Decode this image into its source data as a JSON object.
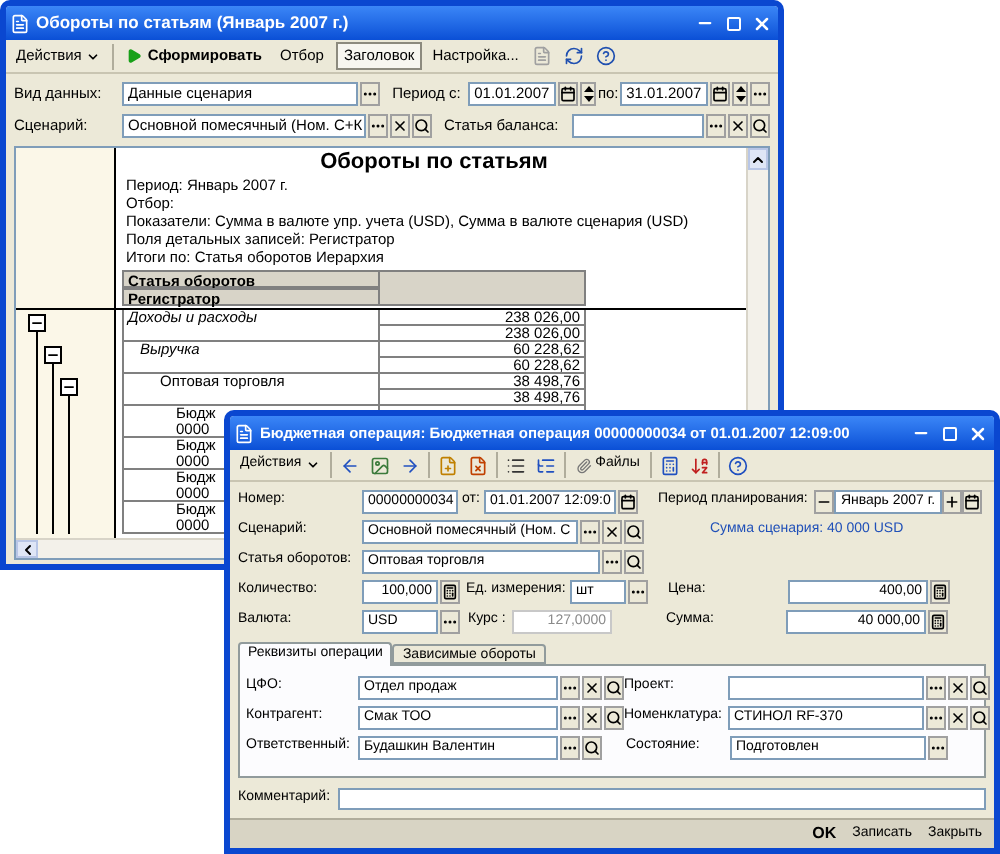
{
  "report_window": {
    "title": "Обороты по статьям (Январь 2007 г.)",
    "toolbar": [
      {
        "kind": "menu",
        "label": "Действия"
      },
      {
        "kind": "run",
        "label": "Сформировать"
      },
      {
        "kind": "toggle",
        "label": "Отбор",
        "selected": false
      },
      {
        "kind": "toggle",
        "label": "Заголовок",
        "selected": true
      },
      {
        "kind": "plain",
        "label": "Настройка..."
      }
    ],
    "data_kind": {
      "label": "Вид данных:",
      "value": "Данные сценария"
    },
    "period": {
      "label": "Период с:",
      "from": {
        "value": "01.01.2007"
      },
      "to_label": "по:",
      "to": {
        "value": "31.01.2007"
      }
    },
    "scenario": {
      "label": "Сценарий:",
      "value": "Основной помесячный (Ном. С+К"
    },
    "balance_item": {
      "label": "Статья баланса:"
    },
    "report": {
      "title": "Обороты по статьям",
      "info": [
        "Период: Январь 2007 г.",
        "Отбор:",
        "Показатели: Сумма в валюте упр. учета (USD), Сумма в валюте сценария (USD)",
        "Поля детальных записей: Регистратор",
        "Итоги по: Статья оборотов Иерархия"
      ],
      "header": [
        "Статья оборотов",
        "Регистратор"
      ],
      "rows": [
        {
          "kind": "group",
          "label": "Доходы и расходы",
          "values": [
            "238 026,00",
            "238 026,00"
          ],
          "expanded": true,
          "children": [
            {
              "kind": "group",
              "label": "Выручка",
              "values": [
                "60 228,62",
                "60 228,62"
              ],
              "expanded": true,
              "children": [
                {
                  "kind": "item",
                  "label": "Оптовая торговля",
                  "values": [
                    "38 498,76",
                    "38 498,76"
                  ],
                  "expanded": true,
                  "children": [
                    {
                      "kind": "record",
                      "label": "Бюдж",
                      "code": "0000"
                    },
                    {
                      "kind": "record",
                      "label": "Бюдж",
                      "code": "0000"
                    },
                    {
                      "kind": "record",
                      "label": "Бюдж",
                      "code": "0000"
                    },
                    {
                      "kind": "record",
                      "label": "Бюдж",
                      "code": "0000"
                    }
                  ]
                }
              ]
            }
          ]
        }
      ]
    }
  },
  "document_window": {
    "title": "Бюджетная операция: Бюджетная операция 00000000034 от 01.01.2007 12:09:00",
    "toolbar": [
      {
        "kind": "menu",
        "label": "Действия"
      },
      {
        "kind": "files",
        "label": "Файлы"
      }
    ],
    "number": {
      "label": "Номер:",
      "value": "00000000034",
      "date_label": "от:",
      "date": {
        "value": "01.01.2007 12:09:0"
      }
    },
    "planning_period": {
      "label": "Период планирования:",
      "value": "Январь 2007 г."
    },
    "scenario": {
      "label": "Сценарий:",
      "value": "Основной помесячный (Ном. С"
    },
    "scenario_sum": "Сумма сценария: 40 000 USD",
    "turnover_item": {
      "label": "Статья оборотов:",
      "value": "Оптовая торговля"
    },
    "quantity": {
      "label": "Количество:",
      "value": "100,000"
    },
    "unit": {
      "label": "Ед. измерения:",
      "value": "шт"
    },
    "price": {
      "label": "Цена:",
      "value": "400,00"
    },
    "currency": {
      "label": "Валюта:",
      "value": "USD"
    },
    "rate": {
      "label": "Курс :",
      "value": "127,0000",
      "disabled": true
    },
    "amount": {
      "label": "Сумма:",
      "value": "40 000,00"
    },
    "tabs": [
      {
        "label": "Реквизиты операции",
        "selected": true
      },
      {
        "label": "Зависимые обороты",
        "selected": false
      }
    ],
    "tab_rows": [
      {
        "left": {
          "label": "ЦФО:",
          "value": "Отдел продаж"
        },
        "right": {
          "label": "Проект:"
        }
      },
      {
        "left": {
          "label": "Контрагент:",
          "value": "Смак ТОО"
        },
        "right": {
          "label": "Номенклатура:",
          "value": "СТИНОЛ RF-370"
        }
      },
      {
        "left": {
          "label": "Ответственный:",
          "value": "Будашкин Валентин"
        },
        "right": {
          "label": "Состояние:",
          "value": "Подготовлен"
        }
      }
    ],
    "comment": {
      "label": "Комментарий:"
    },
    "buttons": [
      {
        "label": "OK",
        "default": true
      },
      {
        "label": "Записать",
        "default": false
      },
      {
        "label": "Закрыть",
        "default": false
      }
    ]
  }
}
